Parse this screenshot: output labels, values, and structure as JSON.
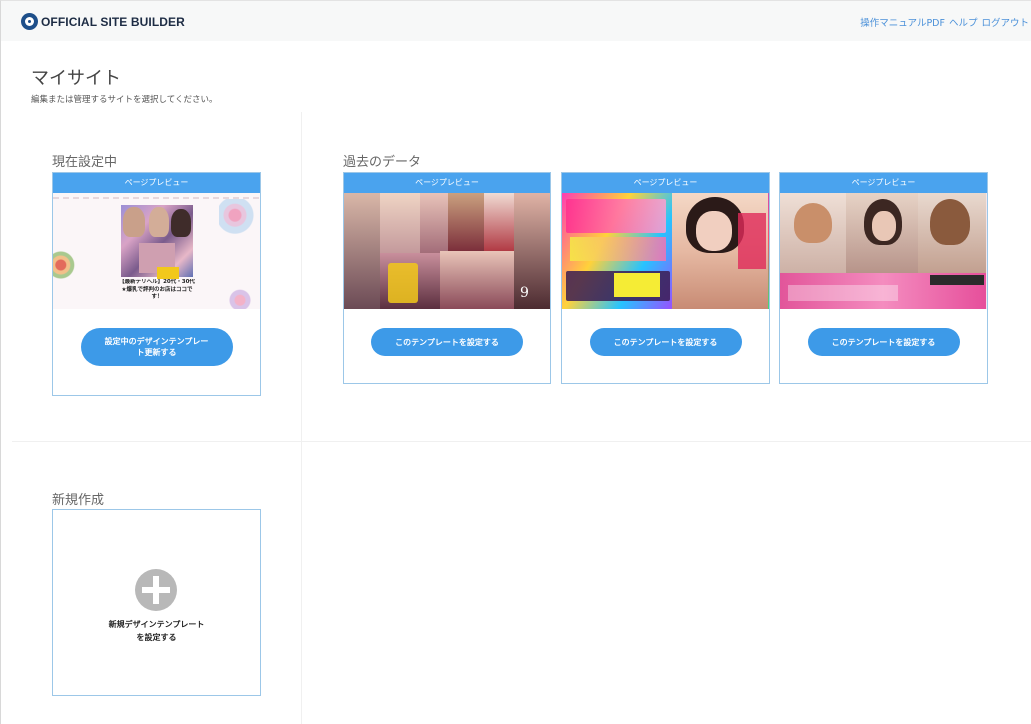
{
  "header": {
    "logo_text": "OFFICIAL SITE BUILDER",
    "links": [
      "操作マニュアルPDF",
      "ヘルプ",
      "ログアウト"
    ]
  },
  "page": {
    "title": "マイサイト",
    "subtitle": "編集または管理するサイトを選択してください。"
  },
  "current": {
    "label": "現在設定中",
    "preview_label": "ページプレビュー",
    "thumb_caption": "【最新デリヘル】20代・30代★爆乳で評判のお店はココです！",
    "button_line1": "設定中のデザインテンプレー",
    "button_line2": "ト更新する"
  },
  "past": {
    "label": "過去のデータ",
    "cards": [
      {
        "preview_label": "ページプレビュー",
        "button": "このテンプレートを設定する"
      },
      {
        "preview_label": "ページプレビュー",
        "button": "このテンプレートを設定する"
      },
      {
        "preview_label": "ページプレビュー",
        "button": "このテンプレートを設定する"
      }
    ]
  },
  "new": {
    "label": "新規作成",
    "line1": "新規デザインテンプレート",
    "line2": "を設定する"
  },
  "colors": {
    "accent": "#3d9ae8",
    "card_header": "#4aa3ee",
    "card_border": "#9cc7e8",
    "link": "#4a90d9"
  }
}
